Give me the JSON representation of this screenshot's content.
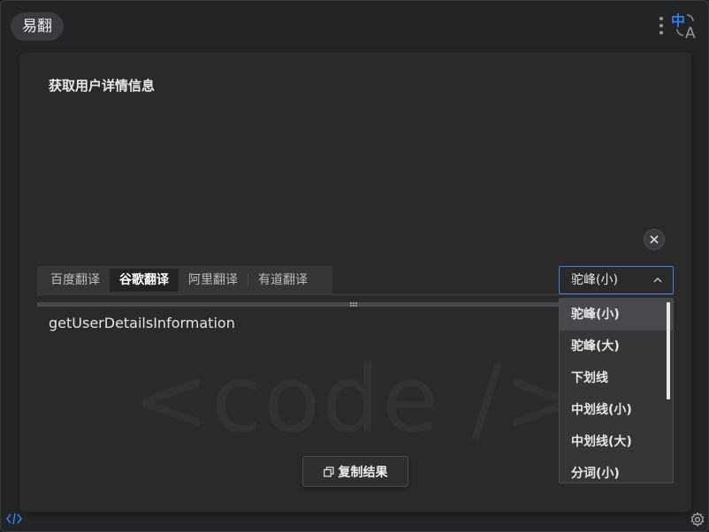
{
  "app": {
    "title": "易翻"
  },
  "source": {
    "text": "获取用户详情信息"
  },
  "tabs": [
    {
      "label": "百度翻译",
      "active": false
    },
    {
      "label": "谷歌翻译",
      "active": true
    },
    {
      "label": "阿里翻译",
      "active": false
    },
    {
      "label": "有道翻译",
      "active": false
    }
  ],
  "case_select": {
    "selected": "驼峰(小)",
    "options": [
      "驼峰(小)",
      "驼峰(大)",
      "下划线",
      "中划线(小)",
      "中划线(大)",
      "分词(小)"
    ]
  },
  "result": {
    "text": "getUserDetailsInformation"
  },
  "watermark": "<code />",
  "copy_button": {
    "label": "复制结果"
  },
  "colors": {
    "accent": "#3f7de0",
    "background": "#232426",
    "card": "#2a2a2b"
  },
  "icons": [
    "menu-dots-icon",
    "translate-logo-icon",
    "close-icon",
    "chevron-up-icon",
    "copy-icon",
    "code-icon",
    "gear-icon"
  ]
}
